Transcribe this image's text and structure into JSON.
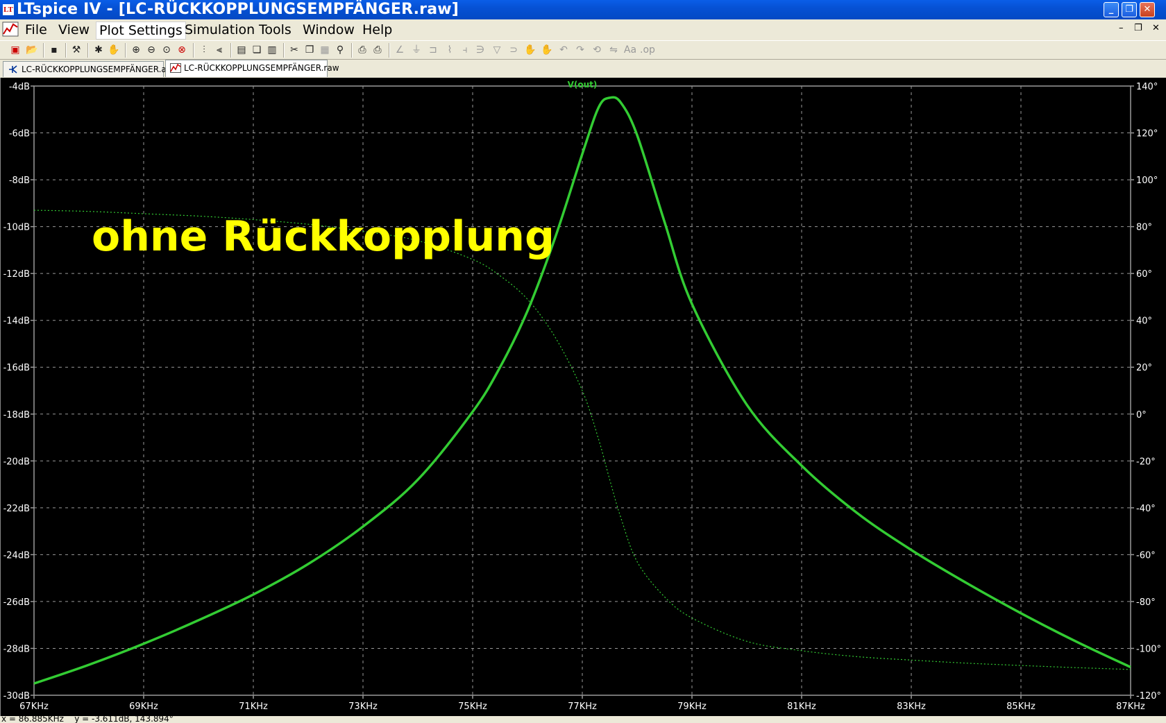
{
  "window": {
    "title": "LTspice IV - [LC-RÜCKKOPPLUNGSEMPFÄNGER.raw]",
    "icon_text": "LT"
  },
  "menu": {
    "items": [
      "File",
      "View",
      "Plot Settings",
      "Simulation",
      "Tools",
      "Window",
      "Help"
    ],
    "active_index": 2
  },
  "tabs": [
    {
      "label": "LC-RÜCKKOPPLUNGSEMPFÄNGER.asc",
      "icon": "schematic-icon",
      "active": false
    },
    {
      "label": "LC-RÜCKKOPPLUNGSEMPFÄNGER.raw",
      "icon": "waveform-icon",
      "active": true
    }
  ],
  "annotation": "ohne Rückkopplung",
  "status": "x = 86.885KHz    y = -3.611dB, 143.894°",
  "colors": {
    "trace": "#33cc33",
    "annotation": "#ffff00",
    "grid": "#9a9a9a",
    "axis_text": "#ffffff",
    "background": "#000000"
  },
  "chart_data": {
    "type": "line",
    "title": "V(out)",
    "xlabel": "",
    "xlim": [
      67,
      87
    ],
    "x_unit": "KHz",
    "x_ticks": [
      "67KHz",
      "69KHz",
      "71KHz",
      "73KHz",
      "75KHz",
      "77KHz",
      "79KHz",
      "81KHz",
      "83KHz",
      "85KHz",
      "87KHz"
    ],
    "ylim_left": [
      -30,
      -4
    ],
    "y_left_ticks": [
      "-4dB",
      "-6dB",
      "-8dB",
      "-10dB",
      "-12dB",
      "-14dB",
      "-16dB",
      "-18dB",
      "-20dB",
      "-22dB",
      "-24dB",
      "-26dB",
      "-28dB",
      "-30dB"
    ],
    "ylim_right": [
      -120,
      140
    ],
    "y_right_ticks": [
      "140°",
      "120°",
      "100°",
      "80°",
      "60°",
      "40°",
      "20°",
      "0°",
      "-20°",
      "-40°",
      "-60°",
      "-80°",
      "-100°",
      "-120°"
    ],
    "grid": true,
    "series": [
      {
        "style": "solid",
        "axis": "left",
        "x": [
          67,
          68,
          69,
          70,
          71,
          72,
          73,
          74,
          75,
          75.5,
          76,
          76.5,
          77,
          77.3,
          77.5,
          77.7,
          78,
          78.5,
          79,
          80,
          81,
          82,
          83,
          84,
          85,
          86,
          87
        ],
        "values": [
          -29.5,
          -28.7,
          -27.8,
          -26.8,
          -25.7,
          -24.4,
          -22.8,
          -20.8,
          -17.9,
          -16.0,
          -13.6,
          -10.5,
          -6.9,
          -4.9,
          -4.5,
          -4.7,
          -6.1,
          -9.8,
          -13.3,
          -17.6,
          -20.2,
          -22.2,
          -23.8,
          -25.2,
          -26.5,
          -27.7,
          -28.8
        ]
      },
      {
        "style": "dotted",
        "axis": "right",
        "x": [
          67,
          68,
          69,
          70,
          71,
          72,
          73,
          74,
          75,
          75.5,
          76,
          76.5,
          77,
          77.3,
          77.5,
          77.7,
          78,
          78.5,
          79,
          80,
          81,
          82,
          83,
          84,
          85,
          86,
          87
        ],
        "values": [
          87,
          86.5,
          85.5,
          84.5,
          83,
          81,
          78,
          74,
          66,
          59,
          49,
          33,
          10,
          -11,
          -28,
          -44,
          -63,
          -78,
          -87,
          -97,
          -101,
          -103.5,
          -105,
          -106.3,
          -107.3,
          -108.2,
          -109
        ]
      }
    ]
  }
}
